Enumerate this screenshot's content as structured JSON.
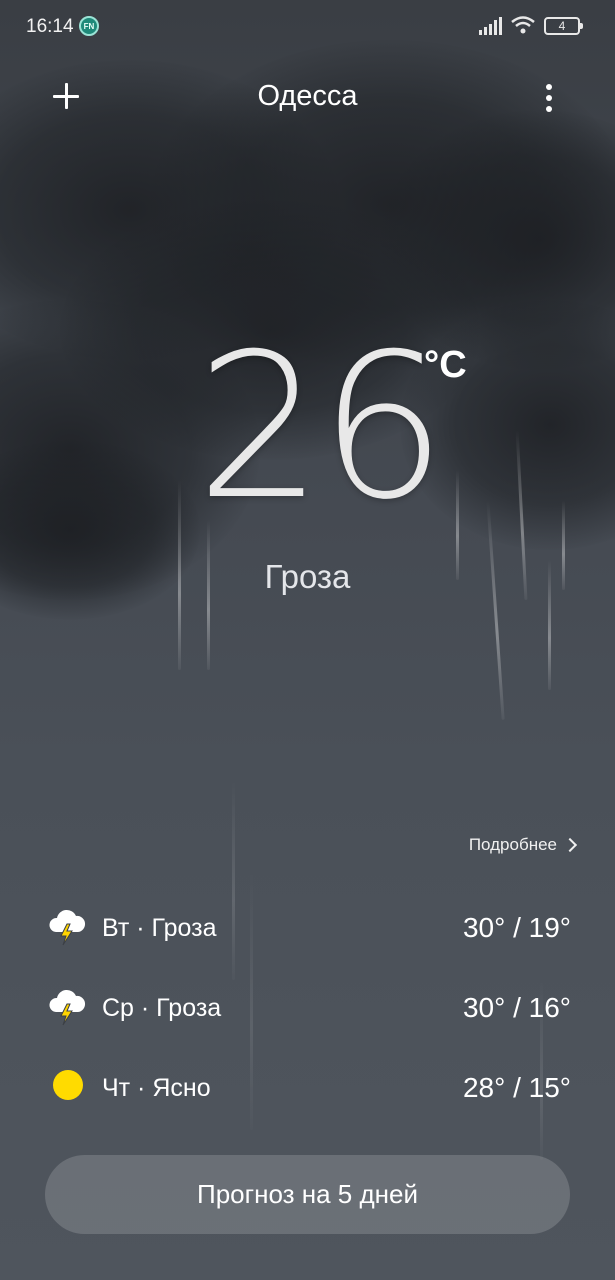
{
  "status_bar": {
    "time": "16:14",
    "app_badge": "FN",
    "battery": "4",
    "icons": [
      "signal-icon",
      "wifi-icon",
      "battery-icon"
    ]
  },
  "header": {
    "city": "Одесса",
    "add_icon": "plus-icon",
    "menu_icon": "more-vertical-icon"
  },
  "current": {
    "temperature": "26",
    "unit": "°C",
    "condition": "Гроза"
  },
  "details_link": "Подробнее",
  "forecast": [
    {
      "label": "Вт · Гроза",
      "temps": "30° / 19°",
      "icon": "thunderstorm-icon"
    },
    {
      "label": "Ср · Гроза",
      "temps": "30° / 16°",
      "icon": "thunderstorm-icon"
    },
    {
      "label": "Чт · Ясно",
      "temps": "28° / 15°",
      "icon": "sun-icon"
    }
  ],
  "forecast_button": "Прогноз на 5 дней",
  "colors": {
    "sun": "#ffdb00",
    "background_top": "#3a3e44",
    "background_bottom": "#4f555d"
  }
}
